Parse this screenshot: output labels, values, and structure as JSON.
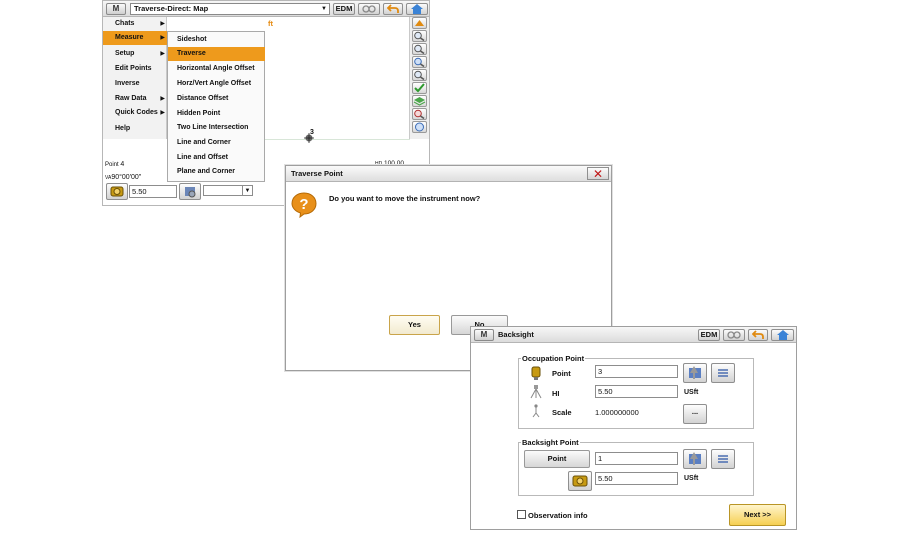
{
  "map_window": {
    "logo": "M",
    "title_select": "Traverse-Direct: Map",
    "edm_label": "EDM",
    "left_menu": [
      {
        "label": "Chats",
        "has_submenu": true
      },
      {
        "label": "Measure",
        "has_submenu": true,
        "active": true
      },
      {
        "label": "Setup",
        "has_submenu": true
      },
      {
        "label": "Edit Points",
        "has_submenu": false
      },
      {
        "label": "Inverse",
        "has_submenu": false
      },
      {
        "label": "Raw Data",
        "has_submenu": true
      },
      {
        "label": "Quick Codes",
        "has_submenu": true
      },
      {
        "label": "Help",
        "has_submenu": false
      }
    ],
    "submenu": [
      "Sideshot",
      "Traverse",
      "Horizontal Angle Offset",
      "Horz/Vert Angle Offset",
      "Distance Offset",
      "Hidden Point",
      "Two Line Intersection",
      "Line and Corner",
      "Line and Offset",
      "Plane and Corner"
    ],
    "unit_fragment": "ft",
    "point_marker_label": "3",
    "point_label": "Point",
    "point_value": "4",
    "va_label": "VA",
    "va_value": "90°00'00\"",
    "hd_label": "HD",
    "hd_value": "100.00",
    "distance_value": "5.50"
  },
  "traverse_dialog": {
    "title": "Traverse Point",
    "message": "Do you want to move the instrument now?",
    "yes_label": "Yes",
    "no_label": "No"
  },
  "backsight_window": {
    "logo": "M",
    "title": "Backsight",
    "edm_label": "EDM",
    "occupation_group": "Occupation Point",
    "point_label": "Point",
    "point_value": "3",
    "hi_label": "HI",
    "hi_value": "5.50",
    "hi_unit": "USft",
    "scale_label": "Scale",
    "scale_value": "1.000000000",
    "ellipsis_label": "...",
    "backsight_group": "Backsight Point",
    "bs_point_button": "Point",
    "bs_point_value": "1",
    "bs_height_value": "5.50",
    "bs_height_unit": "USft",
    "observation_info": "Observation info",
    "next_label": "Next >>"
  },
  "colors": {
    "accent_orange": "#ee9a1c",
    "help_icon": "#e8901a",
    "close_x": "#c01818",
    "home_blue": "#3b83d6"
  }
}
